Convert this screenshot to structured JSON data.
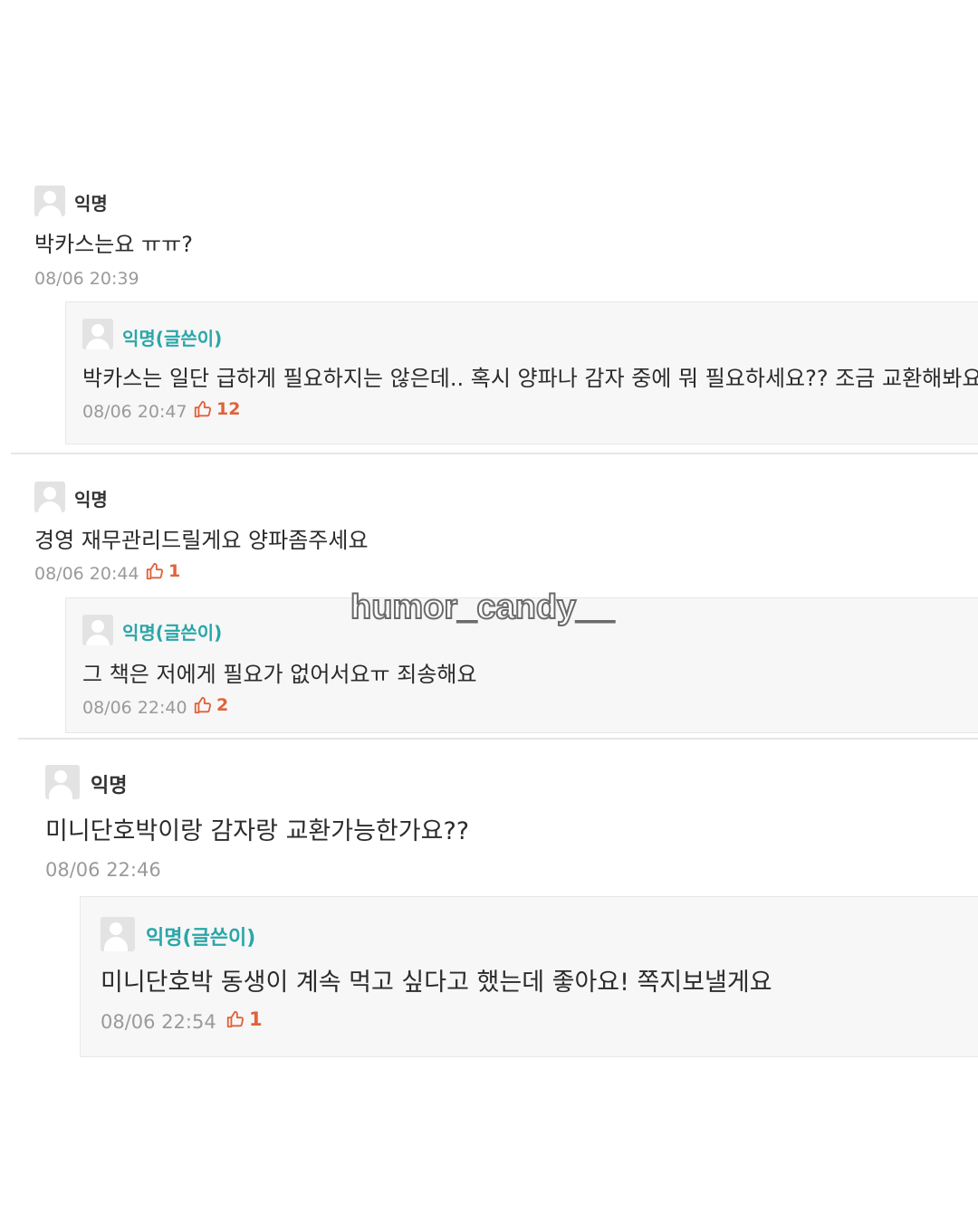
{
  "comments": [
    {
      "author": "익명",
      "text": "박카스는요 ㅠㅠ?",
      "time": "08/06 20:39",
      "reply": {
        "author": "익명(글쓴이)",
        "text": "박카스는 일단 급하게 필요하지는 않은데.. 혹시 양파나 감자 중에 뭐 필요하세요?? 조금 교환해봐요",
        "time": "08/06 20:47",
        "likes": "12"
      }
    },
    {
      "author": "익명",
      "text": "경영 재무관리드릴게요 양파좀주세요",
      "time": "08/06 20:44",
      "likes": "1",
      "reply": {
        "author": "익명(글쓴이)",
        "text": "그 책은 저에게 필요가 없어서요ㅠ 죄송해요",
        "time": "08/06 22:40",
        "likes": "2"
      }
    },
    {
      "author": "익명",
      "text": "미니단호박이랑 감자랑 교환가능한가요??",
      "time": "08/06 22:46",
      "reply": {
        "author": "익명(글쓴이)",
        "text": "미니단호박 동생이 계속 먹고 싶다고 했는데 좋아요! 쪽지보낼게요",
        "time": "08/06 22:54",
        "likes": "1"
      }
    }
  ],
  "watermark": "humor_candy__",
  "colors": {
    "op_author": "#2aa6a8",
    "like": "#e0623a",
    "meta": "#9a9a9a",
    "reply_bg": "#f7f7f7"
  },
  "icons": {
    "avatar": "user-avatar-icon",
    "like": "thumbs-up-icon"
  }
}
